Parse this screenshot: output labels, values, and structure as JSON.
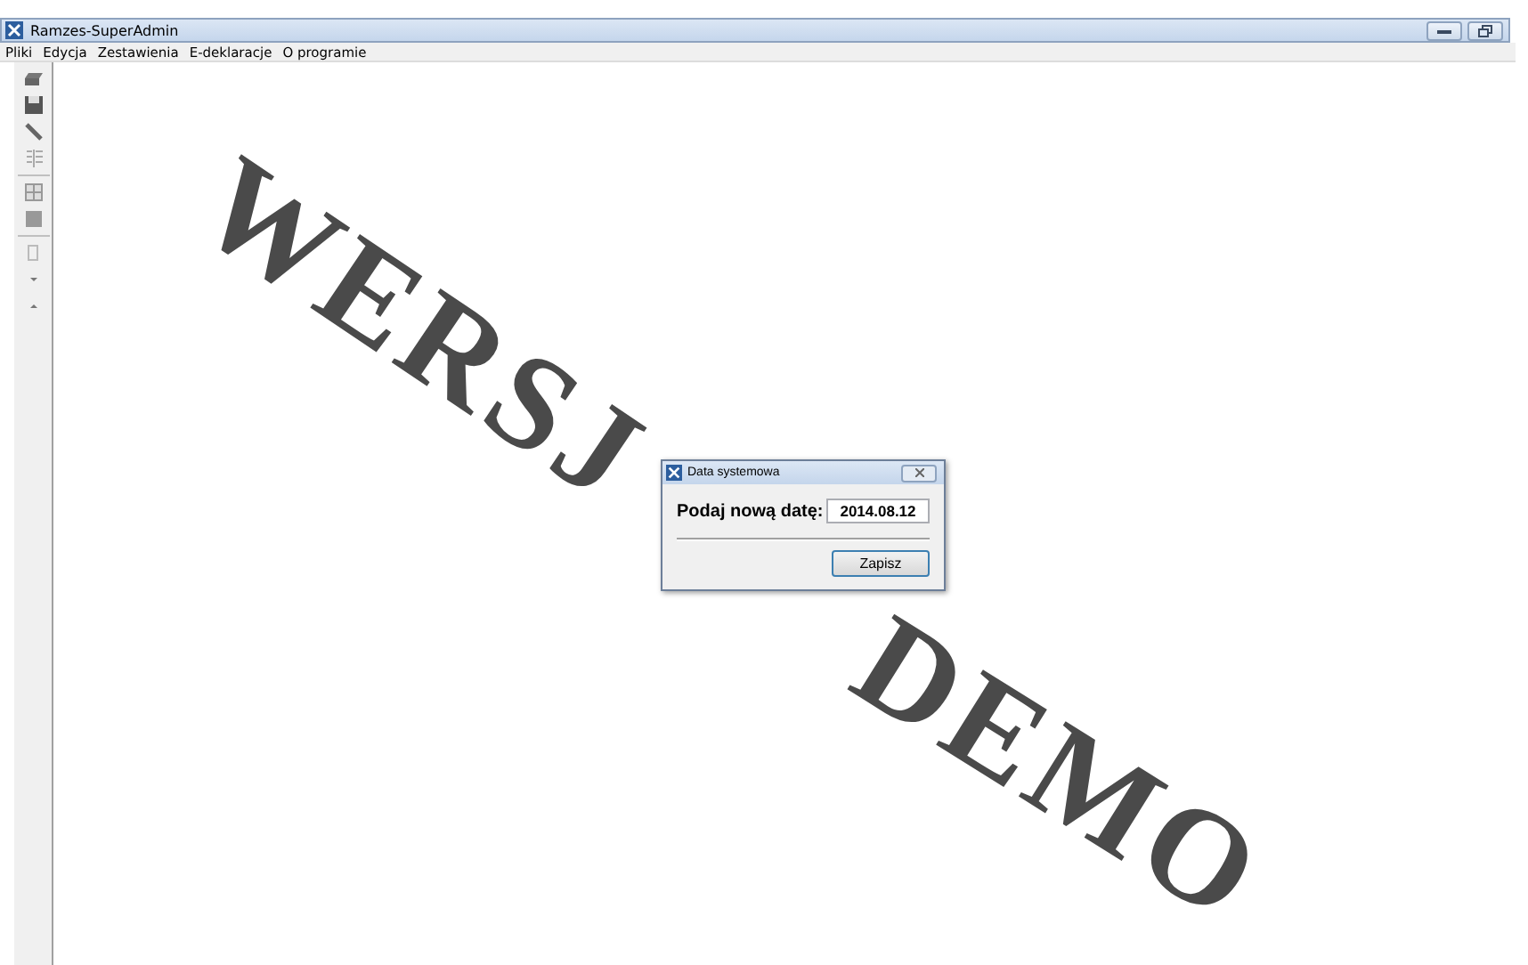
{
  "window": {
    "title": "Ramzes-SuperAdmin"
  },
  "menu": [
    "Pliki",
    "Edycja",
    "Zestawienia",
    "E-deklaracje",
    "O programie"
  ],
  "watermark": [
    "WERSJ",
    "DEMO"
  ],
  "dialog": {
    "title": "Data systemowa",
    "label": "Podaj nową datę:",
    "value": "2014.08.12",
    "button": "Zapisz"
  }
}
